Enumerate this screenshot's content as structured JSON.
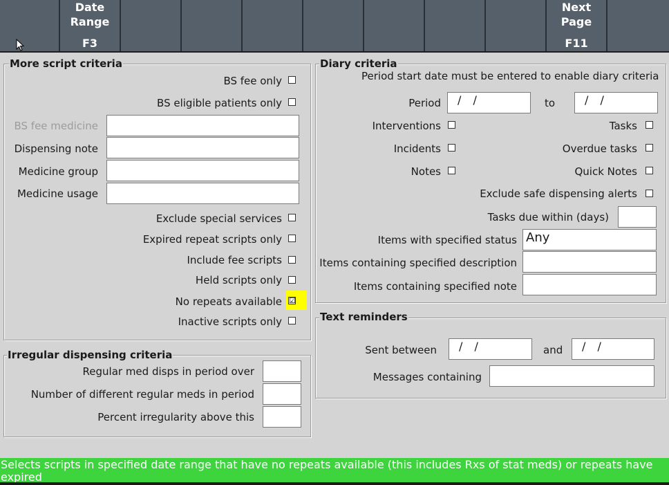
{
  "fkeys": [
    {
      "line1": "",
      "line2": "",
      "key": ""
    },
    {
      "line1": "Date",
      "line2": "Range",
      "key": "F3"
    },
    {
      "line1": "",
      "line2": "",
      "key": ""
    },
    {
      "line1": "",
      "line2": "",
      "key": ""
    },
    {
      "line1": "",
      "line2": "",
      "key": ""
    },
    {
      "line1": "",
      "line2": "",
      "key": ""
    },
    {
      "line1": "",
      "line2": "",
      "key": ""
    },
    {
      "line1": "",
      "line2": "",
      "key": ""
    },
    {
      "line1": "",
      "line2": "",
      "key": ""
    },
    {
      "line1": "Next",
      "line2": "Page",
      "key": "F11"
    },
    {
      "line1": "",
      "line2": "",
      "key": ""
    }
  ],
  "more_script": {
    "title": "More script criteria",
    "bs_fee_only": {
      "label": "BS fee only",
      "checked": false
    },
    "bs_eligible": {
      "label": "BS eligible patients only",
      "checked": false
    },
    "bs_fee_medicine": {
      "label": "BS fee medicine",
      "value": ""
    },
    "dispensing_note": {
      "label": "Dispensing note",
      "value": ""
    },
    "medicine_group": {
      "label": "Medicine group",
      "value": ""
    },
    "medicine_usage": {
      "label": "Medicine usage",
      "value": ""
    },
    "exclude_special": {
      "label": "Exclude special services",
      "checked": false
    },
    "expired_repeat": {
      "label": "Expired repeat scripts only",
      "checked": false
    },
    "include_fee": {
      "label": "Include fee scripts",
      "checked": false
    },
    "held_scripts": {
      "label": "Held scripts only",
      "checked": false
    },
    "no_repeats": {
      "label": "No repeats available",
      "checked": true,
      "mark": "☑"
    },
    "inactive_scripts": {
      "label": "Inactive scripts only",
      "checked": false
    }
  },
  "irregular": {
    "title": "Irregular dispensing criteria",
    "regular_med": {
      "label": "Regular med disps in period over",
      "value": ""
    },
    "num_different": {
      "label": "Number of different regular meds in period",
      "value": ""
    },
    "percent_irreg": {
      "label": "Percent irregularity above this",
      "value": ""
    }
  },
  "diary": {
    "title": "Diary criteria",
    "note": "Period start date must be entered to enable diary criteria",
    "period_label": "Period",
    "period_from": "/ /",
    "to_label": "to",
    "period_to": "/ /",
    "interventions": {
      "label": "Interventions",
      "checked": false
    },
    "tasks": {
      "label": "Tasks",
      "checked": false
    },
    "incidents": {
      "label": "Incidents",
      "checked": false
    },
    "overdue_tasks": {
      "label": "Overdue tasks",
      "checked": false
    },
    "notes": {
      "label": "Notes",
      "checked": false
    },
    "quick_notes": {
      "label": "Quick Notes",
      "checked": false
    },
    "exclude_safe": {
      "label": "Exclude safe dispensing alerts",
      "checked": false
    },
    "tasks_due": {
      "label": "Tasks due within (days)",
      "value": ""
    },
    "items_status": {
      "label": "Items with specified status",
      "value": "Any"
    },
    "items_desc": {
      "label": "Items containing specified description",
      "value": ""
    },
    "items_note": {
      "label": "Items containing specified note",
      "value": ""
    }
  },
  "text_reminders": {
    "title": "Text reminders",
    "sent_between_label": "Sent between",
    "sent_from": "/ /",
    "and_label": "and",
    "sent_to": "/ /",
    "messages_label": "Messages containing",
    "messages_value": ""
  },
  "status": {
    "text": "Selects scripts in specified date range that have no repeats available (this includes Rxs of stat meds) or repeats have expired"
  },
  "colors": {
    "fkey_bg": "#56606a",
    "panel_bg": "#d4d4d4",
    "status_bg": "#3ed43e",
    "highlight": "#ffff00"
  }
}
